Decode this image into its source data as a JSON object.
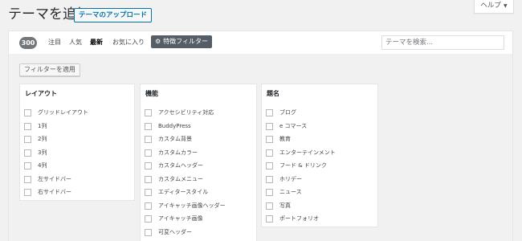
{
  "header": {
    "title": "テーマを追加",
    "upload_label": "テーマのアップロード",
    "help_label": "ヘルプ"
  },
  "filter_bar": {
    "count": "300",
    "tabs": [
      {
        "label": "注目",
        "current": false
      },
      {
        "label": "人気",
        "current": false
      },
      {
        "label": "最新",
        "current": true
      },
      {
        "label": "お気に入り",
        "current": false
      }
    ],
    "feature_filter_label": "特徴フィルター",
    "search_placeholder": "テーマを検索..."
  },
  "drawer": {
    "apply_label": "フィルターを適用",
    "groups": [
      {
        "title": "レイアウト",
        "options": [
          "グリッドレイアウト",
          "1列",
          "2列",
          "3列",
          "4列",
          "左サイドバー",
          "右サイドバー"
        ]
      },
      {
        "title": "機能",
        "options": [
          "アクセシビリティ対応",
          "BuddyPress",
          "カスタム背景",
          "カスタムカラー",
          "カスタムヘッダー",
          "カスタムメニュー",
          "エディタースタイル",
          "アイキャッチ画像ヘッダー",
          "アイキャッチ画像",
          "可変ヘッダー"
        ]
      },
      {
        "title": "題名",
        "options": [
          "ブログ",
          "e コマース",
          "教育",
          "エンターテインメント",
          "フード & ドリンク",
          "ホリデー",
          "ニュース",
          "写真",
          "ポートフォリオ"
        ]
      }
    ]
  },
  "icons": {
    "feature_filter": "gear-icon",
    "help_toggle": "caret-down-icon"
  }
}
